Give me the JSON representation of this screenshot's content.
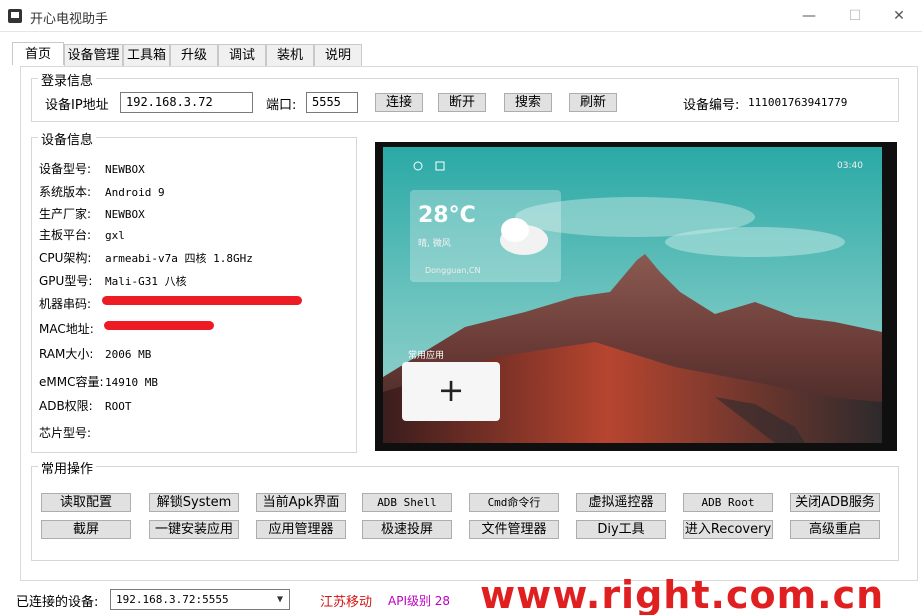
{
  "window": {
    "title": "开心电视助手",
    "min_label": "—",
    "max_label": "☐",
    "close_label": "✕"
  },
  "tabs": [
    "首页",
    "设备管理",
    "工具箱",
    "升级",
    "调试",
    "装机",
    "说明"
  ],
  "login": {
    "group_title": "登录信息",
    "ip_label": "设备IP地址",
    "ip_value": "192.168.3.72",
    "port_label": "端口:",
    "port_value": "5555",
    "connect_label": "连接",
    "disconnect_label": "断开",
    "search_label": "搜索",
    "refresh_label": "刷新",
    "device_id_label": "设备编号:",
    "device_id_value": "111001763941779"
  },
  "device_info": {
    "group_title": "设备信息",
    "rows": [
      {
        "key": "设备型号:",
        "value": "NEWBOX"
      },
      {
        "key": "系统版本:",
        "value": "Android 9"
      },
      {
        "key": "生产厂家:",
        "value": "NEWBOX"
      },
      {
        "key": "主板平台:",
        "value": "gxl"
      },
      {
        "key": "CPU架构:",
        "value": "armeabi-v7a 四核 1.8GHz"
      },
      {
        "key": "GPU型号:",
        "value": "Mali-G31 八核"
      },
      {
        "key": "机器串码:",
        "value": ""
      },
      {
        "key": "MAC地址:",
        "value": ""
      },
      {
        "key": "RAM大小:",
        "value": "2006 MB"
      },
      {
        "key": "eMMC容量:",
        "value": "14910 MB"
      },
      {
        "key": "ADB权限:",
        "value": "ROOT"
      },
      {
        "key": "芯片型号:",
        "value": ""
      }
    ]
  },
  "tv_screen": {
    "temperature": "28°C",
    "weather_sub": "晴, 微风",
    "location": "Dongguan,CN",
    "time": "03:40",
    "apps_label": "常用应用",
    "add_symbol": "+"
  },
  "operations": {
    "group_title": "常用操作",
    "row1": [
      "读取配置",
      "解锁System",
      "当前Apk界面",
      "ADB Shell",
      "Cmd命令行",
      "虚拟遥控器",
      "ADB  Root",
      "关闭ADB服务"
    ],
    "row2": [
      "截屏",
      "一键安装应用",
      "应用管理器",
      "极速投屏",
      "文件管理器",
      "Diy工具",
      "进入Recovery",
      "高级重启"
    ]
  },
  "status": {
    "connected_label": "已连接的设备:",
    "connected_value": "192.168.3.72:5555",
    "isp": "江苏移动",
    "api_level": "API级别 28",
    "watermark": "www.right.com.cn",
    "isp_color": "#d01515",
    "api_color": "#c000c0",
    "link_color": "#1560c0"
  }
}
